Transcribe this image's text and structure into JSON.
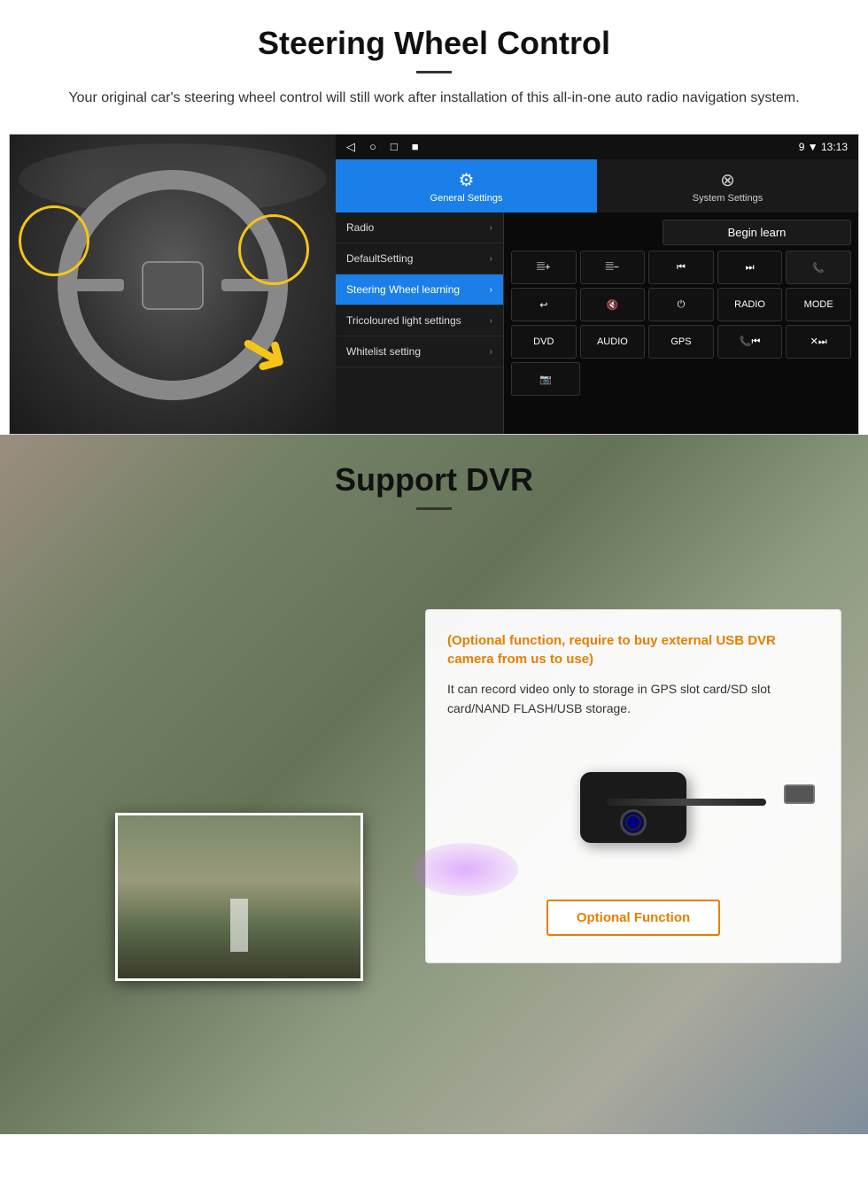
{
  "page": {
    "steering_section": {
      "title": "Steering Wheel Control",
      "subtitle": "Your original car's steering wheel control will still work after installation of this all-in-one auto radio navigation system.",
      "divider": "—"
    },
    "android_ui": {
      "status_bar": "9 ▼ 13:13",
      "nav_icons": [
        "◁",
        "○",
        "□",
        "■"
      ],
      "tab_general": {
        "icon": "⚙",
        "label": "General Settings"
      },
      "tab_system": {
        "icon": "⊗",
        "label": "System Settings"
      },
      "menu_items": [
        {
          "label": "Radio",
          "active": false
        },
        {
          "label": "DefaultSetting",
          "active": false
        },
        {
          "label": "Steering Wheel learning",
          "active": true
        },
        {
          "label": "Tricoloured light settings",
          "active": false
        },
        {
          "label": "Whitelist setting",
          "active": false
        }
      ],
      "begin_learn": "Begin learn",
      "control_buttons": [
        [
          "𝄚+",
          "𝄚−",
          "⏮",
          "⏭",
          "📞"
        ],
        [
          "↩",
          "🔇×",
          "⏻",
          "RADIO",
          "MODE"
        ],
        [
          "DVD",
          "AUDIO",
          "GPS",
          "📞⏮",
          "✕⏭"
        ],
        [
          "📷"
        ]
      ]
    },
    "dvr_section": {
      "title": "Support DVR",
      "optional_text": "(Optional function, require to buy external USB DVR camera from us to use)",
      "description": "It can record video only to storage in GPS slot card/SD slot card/NAND FLASH/USB storage.",
      "optional_button": "Optional Function"
    }
  }
}
